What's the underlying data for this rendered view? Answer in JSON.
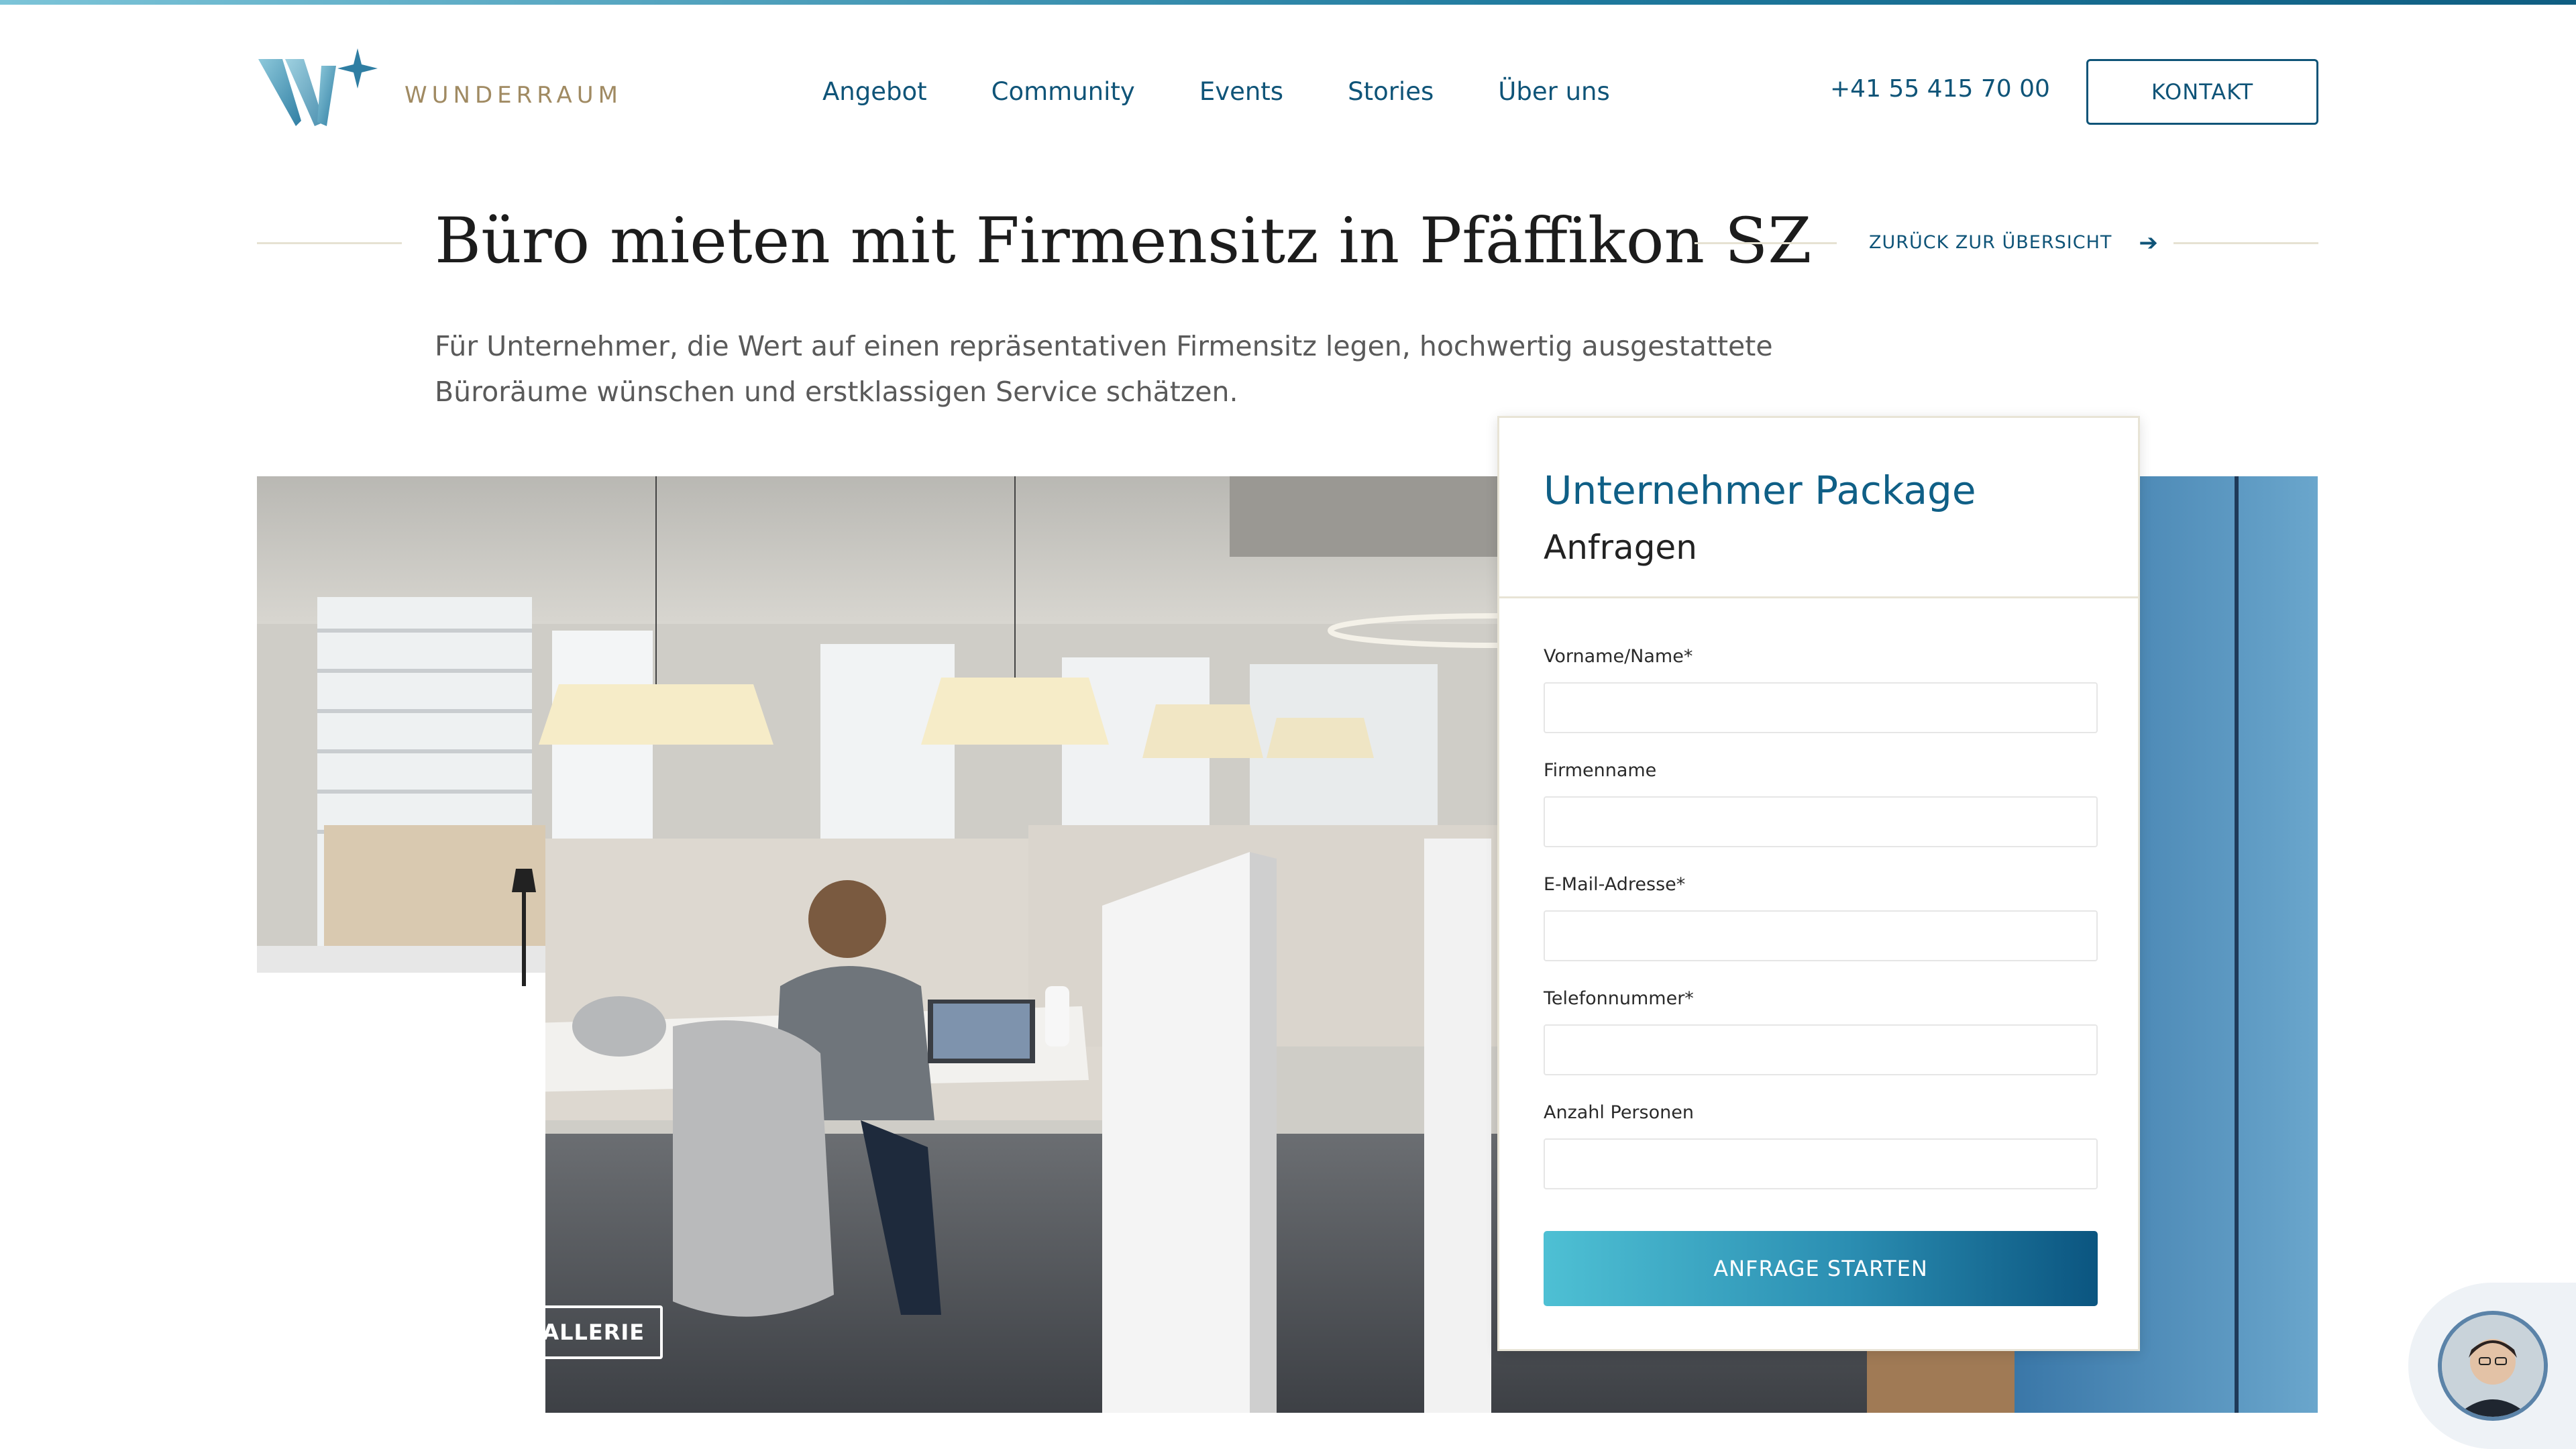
{
  "brand": {
    "logo_text": "WUNDERRAUM",
    "colors": {
      "primary": "#0f5478",
      "accent_gold": "#a08a62",
      "button_gradient_start": "#4ec0d4",
      "button_gradient_end": "#0b5580"
    }
  },
  "nav": {
    "items": [
      "Angebot",
      "Community",
      "Events",
      "Stories",
      "Über uns"
    ]
  },
  "header": {
    "phone": "+41 55 415 70 00",
    "contact_button": "KONTAKT"
  },
  "page": {
    "title": "Büro mieten mit Firmensitz in Pfäffikon SZ",
    "back_link": "ZURÜCK ZUR ÜBERSICHT",
    "back_icon": "arrow-right-icon",
    "lead": "Für Unternehmer, die Wert auf einen repräsentativen Firmensitz legen, hochwertig ausgestattete Büroräume wünschen und erstklassigen Service schätzen."
  },
  "hero": {
    "gallery_button": "FOTO GALLERIE"
  },
  "form": {
    "package_title": "Unternehmer Package",
    "subtitle": "Anfragen",
    "fields": [
      {
        "label": "Vorname/Name*",
        "value": ""
      },
      {
        "label": "Firmenname",
        "value": ""
      },
      {
        "label": "E-Mail-Adresse*",
        "value": ""
      },
      {
        "label": "Telefonnummer*",
        "value": ""
      },
      {
        "label": "Anzahl Personen",
        "value": ""
      }
    ],
    "submit": "ANFRAGE STARTEN"
  },
  "chat": {
    "icon": "chat-avatar-icon"
  }
}
